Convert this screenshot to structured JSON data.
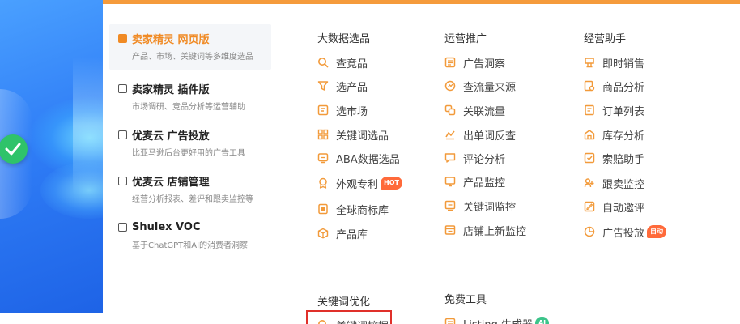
{
  "colors": {
    "accent": "#f08a24",
    "icon_orange": "#f29a3a",
    "badge_hot": "#ff6a3a",
    "badge_new": "#3cc48a",
    "highlight": "#e0302a"
  },
  "products": [
    {
      "title": "卖家精灵 网页版",
      "desc": "产品、市场、关键词等多维度选品",
      "icon": "web-icon",
      "active": true
    },
    {
      "title": "卖家精灵 插件版",
      "desc": "市场调研、竞品分析等运营辅助",
      "icon": "plugin-icon",
      "active": false
    },
    {
      "title": "优麦云 广告投放",
      "desc": "比亚马逊后台更好用的广告工具",
      "icon": "ads-icon",
      "active": false
    },
    {
      "title": "优麦云 店铺管理",
      "desc": "经营分析报表、差评和跟卖监控等",
      "icon": "store-icon",
      "active": false
    },
    {
      "title": "Shulex VOC",
      "desc": "基于ChatGPT和AI的消费者洞察",
      "icon": "voc-icon",
      "active": false
    }
  ],
  "columns": {
    "bigdata": {
      "title": "大数据选品",
      "items": [
        {
          "label": "查竞品",
          "icon": "search-icon"
        },
        {
          "label": "选产品",
          "icon": "filter-icon"
        },
        {
          "label": "选市场",
          "icon": "market-icon"
        },
        {
          "label": "关键词选品",
          "icon": "grid-icon"
        },
        {
          "label": "ABA数据选品",
          "icon": "aba-icon"
        },
        {
          "label": "外观专利",
          "icon": "patent-icon",
          "badge": "HOT"
        },
        {
          "label": "全球商标库",
          "icon": "trademark-icon"
        },
        {
          "label": "产品库",
          "icon": "box-icon"
        }
      ]
    },
    "operation": {
      "title": "运营推广",
      "items": [
        {
          "label": "广告洞察",
          "icon": "ad-insight-icon"
        },
        {
          "label": "查流量来源",
          "icon": "traffic-icon"
        },
        {
          "label": "关联流量",
          "icon": "link-icon"
        },
        {
          "label": "出单词反查",
          "icon": "reverse-icon"
        },
        {
          "label": "评论分析",
          "icon": "comment-icon"
        },
        {
          "label": "产品监控",
          "icon": "monitor-icon"
        },
        {
          "label": "关键词监控",
          "icon": "keyword-monitor-icon"
        },
        {
          "label": "店铺上新监控",
          "icon": "store-new-icon"
        }
      ]
    },
    "assistant": {
      "title": "经营助手",
      "items": [
        {
          "label": "即时销售",
          "icon": "sales-icon"
        },
        {
          "label": "商品分析",
          "icon": "analysis-icon"
        },
        {
          "label": "订单列表",
          "icon": "order-icon"
        },
        {
          "label": "库存分析",
          "icon": "inventory-icon"
        },
        {
          "label": "索赔助手",
          "icon": "claim-icon"
        },
        {
          "label": "跟卖监控",
          "icon": "follow-icon"
        },
        {
          "label": "自动邀评",
          "icon": "review-icon"
        },
        {
          "label": "广告投放",
          "icon": "ad-icon",
          "badge": "自动"
        }
      ]
    },
    "keyword": {
      "title": "关键词优化",
      "items": [
        {
          "label": "关键词挖掘",
          "icon": "dig-icon"
        }
      ]
    },
    "free": {
      "title": "免费工具",
      "items": [
        {
          "label": "Listing 生成器",
          "icon": "listing-icon",
          "badge": "AI"
        }
      ]
    }
  }
}
